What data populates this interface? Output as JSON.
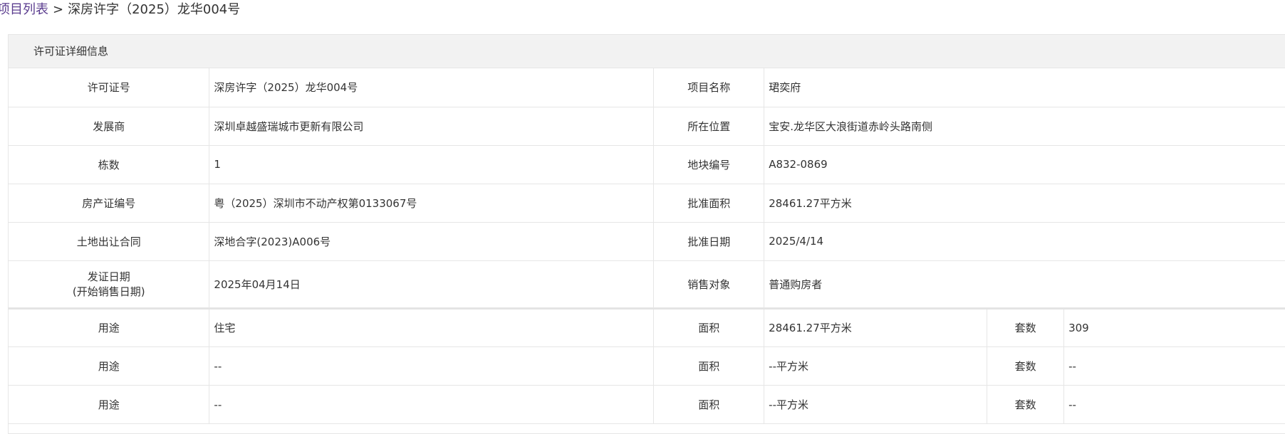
{
  "breadcrumb": {
    "link": "项目列表",
    "separator": ">",
    "current": "深房许字（2025）龙华004号"
  },
  "panel": {
    "title": "许可证详细信息"
  },
  "details": [
    {
      "l1": "许可证号",
      "v1": "深房许字（2025）龙华004号",
      "l2": "项目名称",
      "v2": "珺奕府"
    },
    {
      "l1": "发展商",
      "v1": "深圳卓越盛瑞城市更新有限公司",
      "l2": "所在位置",
      "v2": "宝安.龙华区大浪街道赤岭头路南侧"
    },
    {
      "l1": "栋数",
      "v1": "1",
      "l2": "地块编号",
      "v2": "A832-0869"
    },
    {
      "l1": "房产证编号",
      "v1": "粤（2025）深圳市不动产权第0133067号",
      "l2": "批准面积",
      "v2": "28461.27平方米"
    },
    {
      "l1": "土地出让合同",
      "v1": "深地合字(2023)A006号",
      "l2": "批准日期",
      "v2": "2025/4/14"
    },
    {
      "l1a": "发证日期",
      "l1b": "(开始销售日期)",
      "v1": "2025年04月14日",
      "l2": "销售对象",
      "v2": "普通购房者"
    }
  ],
  "usage_rows": [
    {
      "use_label": "用途",
      "use": "住宅",
      "area_label": "面积",
      "area": "28461.27平方米",
      "count_label": "套数",
      "count": "309"
    },
    {
      "use_label": "用途",
      "use": "--",
      "area_label": "面积",
      "area": "--平方米",
      "count_label": "套数",
      "count": "--"
    },
    {
      "use_label": "用途",
      "use": "--",
      "area_label": "面积",
      "area": "--平方米",
      "count_label": "套数",
      "count": "--"
    }
  ]
}
